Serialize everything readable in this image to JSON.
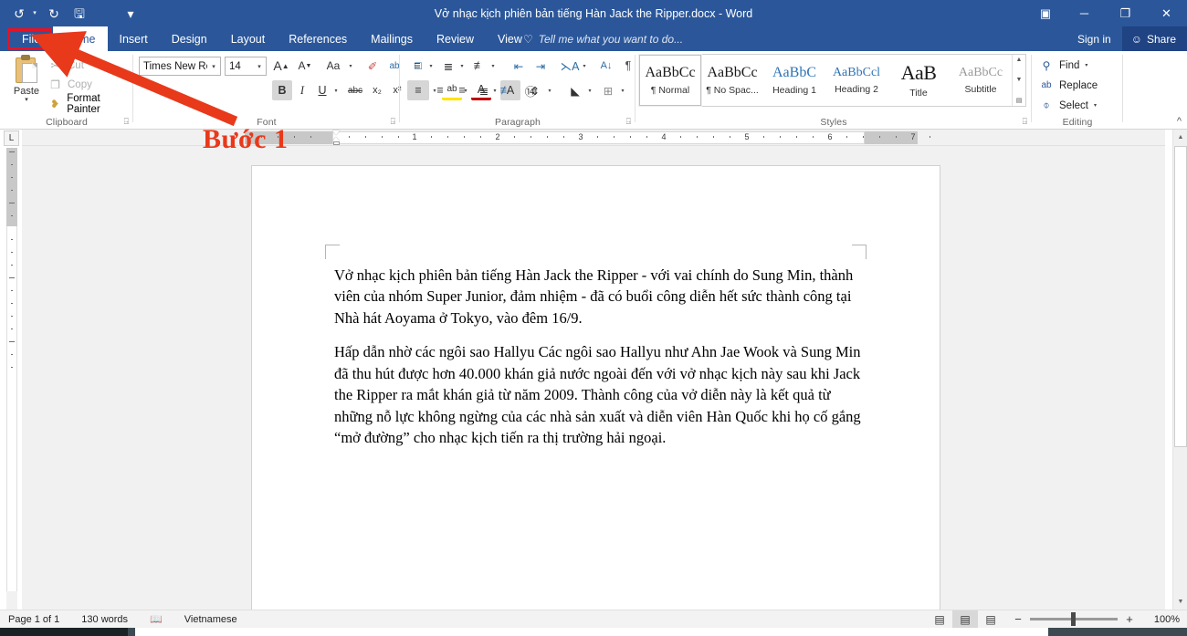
{
  "titlebar": {
    "document_title": "Vở nhạc kịch phiên bản tiếng Hàn Jack the Ripper.docx - Word",
    "qat": [
      {
        "name": "undo-icon",
        "glyph": "↺"
      },
      {
        "name": "redo-icon",
        "glyph": "↻"
      },
      {
        "name": "save-icon",
        "glyph": "🖫"
      },
      {
        "name": "customize-qat-icon",
        "glyph": "▾"
      }
    ],
    "window_controls": [
      {
        "name": "ribbon-display-options-icon",
        "glyph": "▣"
      },
      {
        "name": "minimize-button",
        "glyph": "─"
      },
      {
        "name": "restore-button",
        "glyph": "❐"
      },
      {
        "name": "close-button",
        "glyph": "✕"
      }
    ]
  },
  "tabs": {
    "file": "File",
    "items": [
      "Home",
      "Insert",
      "Design",
      "Layout",
      "References",
      "Mailings",
      "Review",
      "View"
    ],
    "active": "Home",
    "tellme_placeholder": "Tell me what you want to do...",
    "sign_in": "Sign in",
    "share": "Share"
  },
  "ribbon": {
    "clipboard": {
      "label": "Clipboard",
      "paste": "Paste",
      "cut": "Cut",
      "copy": "Copy",
      "format_painter": "Format Painter"
    },
    "font": {
      "label": "Font",
      "font_name": "Times New Ro",
      "font_size": "14",
      "buttons": [
        {
          "name": "grow-font-icon",
          "glyph": "A"
        },
        {
          "name": "shrink-font-icon",
          "glyph": "A"
        },
        {
          "name": "change-case-icon",
          "glyph": "Aa"
        },
        {
          "name": "clear-formatting-icon",
          "glyph": "✐"
        },
        {
          "name": "phonetic-guide-icon",
          "glyph": "ab"
        },
        {
          "name": "character-border-icon",
          "glyph": "A"
        },
        {
          "name": "bold-icon",
          "glyph": "B"
        },
        {
          "name": "italic-icon",
          "glyph": "I"
        },
        {
          "name": "underline-icon",
          "glyph": "U"
        },
        {
          "name": "strikethrough-icon",
          "glyph": "abc"
        },
        {
          "name": "subscript-icon",
          "glyph": "x₂"
        },
        {
          "name": "superscript-icon",
          "glyph": "x²"
        },
        {
          "name": "text-effects-icon",
          "glyph": "A"
        },
        {
          "name": "text-highlight-color-icon",
          "glyph": "ab"
        },
        {
          "name": "font-color-icon",
          "glyph": "A"
        },
        {
          "name": "character-shading-icon",
          "glyph": "A"
        },
        {
          "name": "enclose-characters-icon",
          "glyph": "㊐"
        }
      ]
    },
    "paragraph": {
      "label": "Paragraph",
      "buttons": [
        {
          "name": "bullets-icon",
          "glyph": "≔"
        },
        {
          "name": "numbering-icon",
          "glyph": "≕"
        },
        {
          "name": "multilevel-list-icon",
          "glyph": "≖"
        },
        {
          "name": "decrease-indent-icon",
          "glyph": "⇤"
        },
        {
          "name": "increase-indent-icon",
          "glyph": "⇥"
        },
        {
          "name": "asian-layout-icon",
          "glyph": "A"
        },
        {
          "name": "sort-icon",
          "glyph": "↓"
        },
        {
          "name": "show-formatting-marks-icon",
          "glyph": "¶"
        },
        {
          "name": "align-left-icon",
          "glyph": "≡"
        },
        {
          "name": "align-center-icon",
          "glyph": "≡"
        },
        {
          "name": "align-right-icon",
          "glyph": "≡"
        },
        {
          "name": "justify-icon",
          "glyph": "≡"
        },
        {
          "name": "distributed-icon",
          "glyph": "≣"
        },
        {
          "name": "line-spacing-icon",
          "glyph": "⇕"
        },
        {
          "name": "shading-icon",
          "glyph": "⬧"
        },
        {
          "name": "borders-icon",
          "glyph": "⊞"
        }
      ]
    },
    "styles": {
      "label": "Styles",
      "items": [
        {
          "preview": "AaBbCc",
          "name": "¶ Normal",
          "kind": "normal",
          "active": true
        },
        {
          "preview": "AaBbCc",
          "name": "¶ No Spac...",
          "kind": "normal",
          "active": false
        },
        {
          "preview": "AaBbC",
          "name": "Heading 1",
          "kind": "blue",
          "active": false
        },
        {
          "preview": "AaBbCcl",
          "name": "Heading 2",
          "kind": "blue",
          "active": false
        },
        {
          "preview": "AaB",
          "name": "Title",
          "kind": "title",
          "active": false
        },
        {
          "preview": "AaBbCc",
          "name": "Subtitle",
          "kind": "sub",
          "active": false
        }
      ]
    },
    "editing": {
      "label": "Editing",
      "find": "Find",
      "replace": "Replace",
      "select": "Select"
    }
  },
  "ruler": {
    "numbers": [
      "1",
      "2",
      "3",
      "4",
      "5",
      "6",
      "7"
    ],
    "tab_selector_glyph": "L"
  },
  "document": {
    "paragraphs": [
      "Vở nhạc kịch phiên bản tiếng Hàn Jack the Ripper - với vai chính do Sung Min, thành viên của nhóm Super Junior, đảm nhiệm - đã có buổi công diễn hết sức thành công tại Nhà hát Aoyama ở Tokyo, vào đêm 16/9.",
      "Hấp dẫn nhờ các ngôi sao Hallyu Các ngôi sao Hallyu như Ahn Jae Wook và Sung Min đã thu hút được hơn 40.000 khán giả nước ngoài đến với vở nhạc kịch này sau khi Jack the Ripper ra mắt khán giả từ năm 2009. Thành công của vở diễn này là kết quả từ những nỗ lực không ngừng của các nhà sản xuất và diễn viên Hàn Quốc khi họ cố gắng “mở đường” cho nhạc kịch tiến ra thị trường hải ngoại."
    ]
  },
  "statusbar": {
    "page": "Page 1 of 1",
    "words": "130 words",
    "proofing_icon": "proofing-errors-icon",
    "language": "Vietnamese",
    "views": [
      {
        "name": "read-mode-button",
        "glyph": "▤",
        "selected": false
      },
      {
        "name": "print-layout-button",
        "glyph": "▤",
        "selected": true
      },
      {
        "name": "web-layout-button",
        "glyph": "▤",
        "selected": false
      }
    ],
    "zoom_out": "−",
    "zoom_in": "+",
    "zoom_level": "100%"
  },
  "annotations": {
    "step_label": "Bước 1",
    "accent_color": "#e8391b",
    "highlight_color": "#e81123"
  }
}
